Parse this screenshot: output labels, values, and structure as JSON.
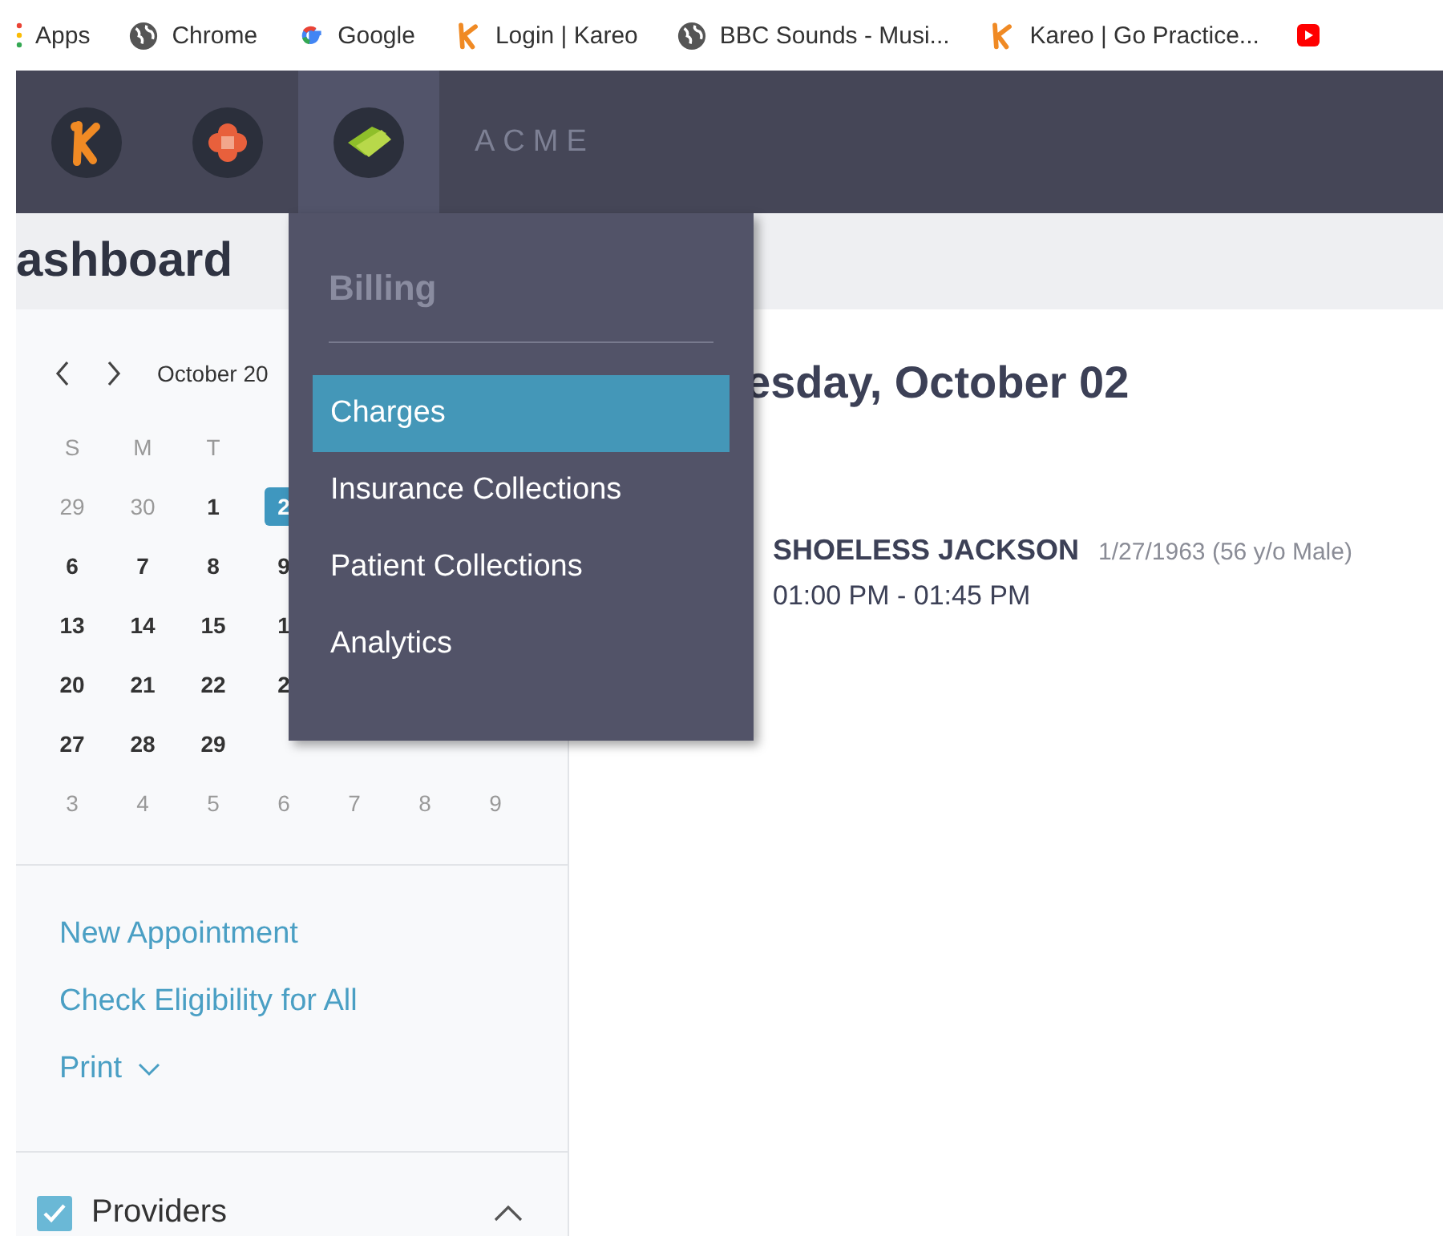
{
  "bookmarks": [
    {
      "kind": "apps",
      "label": "Apps"
    },
    {
      "kind": "globe",
      "label": "Chrome"
    },
    {
      "kind": "google",
      "label": "Google"
    },
    {
      "kind": "k",
      "label": "Login | Kareo"
    },
    {
      "kind": "globe",
      "label": "BBC Sounds - Musi..."
    },
    {
      "kind": "k",
      "label": "Kareo | Go Practice..."
    },
    {
      "kind": "video"
    }
  ],
  "nav": {
    "apps": [
      {
        "kind": "k",
        "selected": false
      },
      {
        "kind": "bandage",
        "selected": false
      },
      {
        "kind": "money",
        "selected": true
      }
    ],
    "practice": "ACME"
  },
  "page_title": "ashboard",
  "calendar": {
    "month": "October 20",
    "weekdays": [
      "S",
      "M",
      "T"
    ],
    "weeks": [
      [
        {
          "day": "29",
          "outside": true,
          "selected": false
        },
        {
          "day": "30",
          "outside": true,
          "selected": false
        },
        {
          "day": "1",
          "outside": false,
          "selected": false
        },
        {
          "day": "2",
          "outside": false,
          "selected": true
        }
      ],
      [
        {
          "day": "6",
          "outside": false,
          "selected": false
        },
        {
          "day": "7",
          "outside": false,
          "selected": false
        },
        {
          "day": "8",
          "outside": false,
          "selected": false
        },
        {
          "day": "9",
          "outside": false,
          "selected": false
        }
      ],
      [
        {
          "day": "13",
          "outside": false,
          "selected": false
        },
        {
          "day": "14",
          "outside": false,
          "selected": false
        },
        {
          "day": "15",
          "outside": false,
          "selected": false
        },
        {
          "day": "1",
          "outside": false,
          "selected": false
        }
      ],
      [
        {
          "day": "20",
          "outside": false,
          "selected": false
        },
        {
          "day": "21",
          "outside": false,
          "selected": false
        },
        {
          "day": "22",
          "outside": false,
          "selected": false
        },
        {
          "day": "2",
          "outside": false,
          "selected": false
        }
      ],
      [
        {
          "day": "27",
          "outside": false,
          "selected": false
        },
        {
          "day": "28",
          "outside": false,
          "selected": false
        },
        {
          "day": "29",
          "outside": false,
          "selected": false
        }
      ],
      [
        {
          "day": "3",
          "outside": true,
          "selected": false
        },
        {
          "day": "4",
          "outside": true,
          "selected": false
        },
        {
          "day": "5",
          "outside": true,
          "selected": false
        },
        {
          "day": "6",
          "outside": true,
          "selected": false
        },
        {
          "day": "7",
          "outside": true,
          "selected": false
        },
        {
          "day": "8",
          "outside": true,
          "selected": false
        },
        {
          "day": "9",
          "outside": true,
          "selected": false
        }
      ]
    ]
  },
  "actions": [
    "New Appointment",
    "Check Eligibility for All",
    "Print"
  ],
  "providers": {
    "label": "Providers",
    "checked": true,
    "expanded": true
  },
  "day_title": "esday, October 02",
  "appointments": [
    {
      "patient": "SHOELESS JACKSON",
      "details": "1/27/1963 (56 y/o Male)",
      "time": "01:00 PM - 01:45 PM"
    }
  ],
  "menu": {
    "title": "Billing",
    "items": [
      {
        "label": "Charges",
        "selected": true
      },
      {
        "label": "Insurance Collections",
        "selected": false
      },
      {
        "label": "Patient Collections",
        "selected": false
      },
      {
        "label": "Analytics",
        "selected": false
      }
    ]
  }
}
